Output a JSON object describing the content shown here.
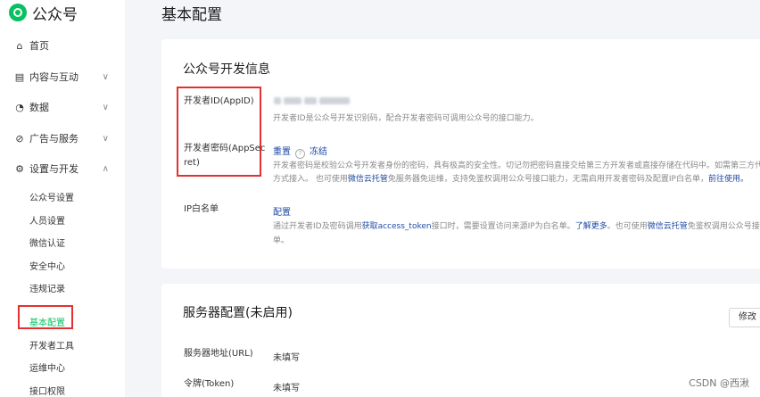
{
  "app": {
    "logo_text": "公众号"
  },
  "sidebar": {
    "items": [
      {
        "label": "首页",
        "icon": "home-icon"
      },
      {
        "label": "内容与互动",
        "icon": "document-icon"
      },
      {
        "label": "数据",
        "icon": "chart-icon"
      },
      {
        "label": "广告与服务",
        "icon": "compass-icon"
      },
      {
        "label": "设置与开发",
        "icon": "gear-icon"
      }
    ],
    "sub_items": [
      {
        "label": "公众号设置"
      },
      {
        "label": "人员设置"
      },
      {
        "label": "微信认证"
      },
      {
        "label": "安全中心"
      },
      {
        "label": "违规记录"
      },
      {
        "label": "基本配置",
        "active": true
      },
      {
        "label": "开发者工具"
      },
      {
        "label": "运维中心"
      },
      {
        "label": "接口权限"
      }
    ]
  },
  "page": {
    "title": "基本配置"
  },
  "dev_info": {
    "title": "公众号开发信息",
    "appid": {
      "label": "开发者ID(AppID)",
      "desc": "开发者ID是公众号开发识别码，配合开发者密码可调用公众号的接口能力。"
    },
    "secret": {
      "label_line1": "开发者密码(AppSec",
      "label_line2": "ret)",
      "reset": "重置",
      "freeze": "冻结",
      "desc_line1": "开发者密码是校验公众号开发者身份的密码，具有极高的安全性。切记勿把密码直接交给第三方开发者或直接存储在代码中。如需第三方代",
      "desc_line2_a": "方式接入。 也可使用",
      "desc_line2_link1": "微信云托管",
      "desc_line2_b": "免服务器免运维，支持免鉴权调用公众号接口能力，无需启用开发者密码及配置IP白名单，",
      "desc_line2_link2": "前往使用。"
    },
    "ip": {
      "label": "IP白名单",
      "action": "配置",
      "desc_a": "通过开发者ID及密码调用",
      "desc_link1": "获取access_token",
      "desc_b": "接口时，需要设置访问来源IP为白名单。",
      "desc_link2": "了解更多",
      "desc_c": "。也可使用",
      "desc_link3": "微信云托管",
      "desc_d": "免鉴权调用公众号接口",
      "desc_line2": "单。"
    }
  },
  "server": {
    "title": "服务器配置(未启用)",
    "edit_button": "修改",
    "url": {
      "label": "服务器地址(URL)",
      "value": "未填写"
    },
    "token": {
      "label": "令牌(Token)",
      "value": "未填写"
    }
  },
  "watermark": "CSDN @西湫"
}
